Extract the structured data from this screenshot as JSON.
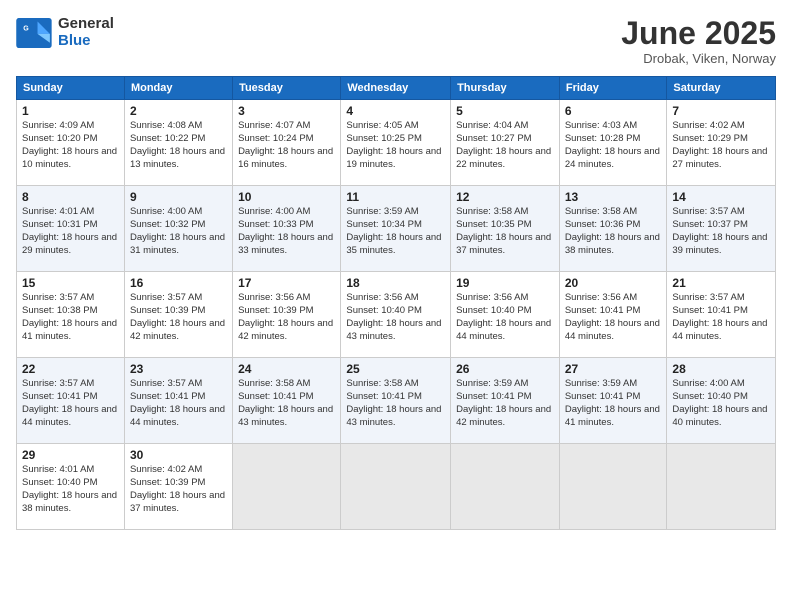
{
  "header": {
    "logo_general": "General",
    "logo_blue": "Blue",
    "month_title": "June 2025",
    "location": "Drobak, Viken, Norway"
  },
  "weekdays": [
    "Sunday",
    "Monday",
    "Tuesday",
    "Wednesday",
    "Thursday",
    "Friday",
    "Saturday"
  ],
  "weeks": [
    [
      {
        "day": "1",
        "sunrise": "Sunrise: 4:09 AM",
        "sunset": "Sunset: 10:20 PM",
        "daylight": "Daylight: 18 hours and 10 minutes."
      },
      {
        "day": "2",
        "sunrise": "Sunrise: 4:08 AM",
        "sunset": "Sunset: 10:22 PM",
        "daylight": "Daylight: 18 hours and 13 minutes."
      },
      {
        "day": "3",
        "sunrise": "Sunrise: 4:07 AM",
        "sunset": "Sunset: 10:24 PM",
        "daylight": "Daylight: 18 hours and 16 minutes."
      },
      {
        "day": "4",
        "sunrise": "Sunrise: 4:05 AM",
        "sunset": "Sunset: 10:25 PM",
        "daylight": "Daylight: 18 hours and 19 minutes."
      },
      {
        "day": "5",
        "sunrise": "Sunrise: 4:04 AM",
        "sunset": "Sunset: 10:27 PM",
        "daylight": "Daylight: 18 hours and 22 minutes."
      },
      {
        "day": "6",
        "sunrise": "Sunrise: 4:03 AM",
        "sunset": "Sunset: 10:28 PM",
        "daylight": "Daylight: 18 hours and 24 minutes."
      },
      {
        "day": "7",
        "sunrise": "Sunrise: 4:02 AM",
        "sunset": "Sunset: 10:29 PM",
        "daylight": "Daylight: 18 hours and 27 minutes."
      }
    ],
    [
      {
        "day": "8",
        "sunrise": "Sunrise: 4:01 AM",
        "sunset": "Sunset: 10:31 PM",
        "daylight": "Daylight: 18 hours and 29 minutes."
      },
      {
        "day": "9",
        "sunrise": "Sunrise: 4:00 AM",
        "sunset": "Sunset: 10:32 PM",
        "daylight": "Daylight: 18 hours and 31 minutes."
      },
      {
        "day": "10",
        "sunrise": "Sunrise: 4:00 AM",
        "sunset": "Sunset: 10:33 PM",
        "daylight": "Daylight: 18 hours and 33 minutes."
      },
      {
        "day": "11",
        "sunrise": "Sunrise: 3:59 AM",
        "sunset": "Sunset: 10:34 PM",
        "daylight": "Daylight: 18 hours and 35 minutes."
      },
      {
        "day": "12",
        "sunrise": "Sunrise: 3:58 AM",
        "sunset": "Sunset: 10:35 PM",
        "daylight": "Daylight: 18 hours and 37 minutes."
      },
      {
        "day": "13",
        "sunrise": "Sunrise: 3:58 AM",
        "sunset": "Sunset: 10:36 PM",
        "daylight": "Daylight: 18 hours and 38 minutes."
      },
      {
        "day": "14",
        "sunrise": "Sunrise: 3:57 AM",
        "sunset": "Sunset: 10:37 PM",
        "daylight": "Daylight: 18 hours and 39 minutes."
      }
    ],
    [
      {
        "day": "15",
        "sunrise": "Sunrise: 3:57 AM",
        "sunset": "Sunset: 10:38 PM",
        "daylight": "Daylight: 18 hours and 41 minutes."
      },
      {
        "day": "16",
        "sunrise": "Sunrise: 3:57 AM",
        "sunset": "Sunset: 10:39 PM",
        "daylight": "Daylight: 18 hours and 42 minutes."
      },
      {
        "day": "17",
        "sunrise": "Sunrise: 3:56 AM",
        "sunset": "Sunset: 10:39 PM",
        "daylight": "Daylight: 18 hours and 42 minutes."
      },
      {
        "day": "18",
        "sunrise": "Sunrise: 3:56 AM",
        "sunset": "Sunset: 10:40 PM",
        "daylight": "Daylight: 18 hours and 43 minutes."
      },
      {
        "day": "19",
        "sunrise": "Sunrise: 3:56 AM",
        "sunset": "Sunset: 10:40 PM",
        "daylight": "Daylight: 18 hours and 44 minutes."
      },
      {
        "day": "20",
        "sunrise": "Sunrise: 3:56 AM",
        "sunset": "Sunset: 10:41 PM",
        "daylight": "Daylight: 18 hours and 44 minutes."
      },
      {
        "day": "21",
        "sunrise": "Sunrise: 3:57 AM",
        "sunset": "Sunset: 10:41 PM",
        "daylight": "Daylight: 18 hours and 44 minutes."
      }
    ],
    [
      {
        "day": "22",
        "sunrise": "Sunrise: 3:57 AM",
        "sunset": "Sunset: 10:41 PM",
        "daylight": "Daylight: 18 hours and 44 minutes."
      },
      {
        "day": "23",
        "sunrise": "Sunrise: 3:57 AM",
        "sunset": "Sunset: 10:41 PM",
        "daylight": "Daylight: 18 hours and 44 minutes."
      },
      {
        "day": "24",
        "sunrise": "Sunrise: 3:58 AM",
        "sunset": "Sunset: 10:41 PM",
        "daylight": "Daylight: 18 hours and 43 minutes."
      },
      {
        "day": "25",
        "sunrise": "Sunrise: 3:58 AM",
        "sunset": "Sunset: 10:41 PM",
        "daylight": "Daylight: 18 hours and 43 minutes."
      },
      {
        "day": "26",
        "sunrise": "Sunrise: 3:59 AM",
        "sunset": "Sunset: 10:41 PM",
        "daylight": "Daylight: 18 hours and 42 minutes."
      },
      {
        "day": "27",
        "sunrise": "Sunrise: 3:59 AM",
        "sunset": "Sunset: 10:41 PM",
        "daylight": "Daylight: 18 hours and 41 minutes."
      },
      {
        "day": "28",
        "sunrise": "Sunrise: 4:00 AM",
        "sunset": "Sunset: 10:40 PM",
        "daylight": "Daylight: 18 hours and 40 minutes."
      }
    ],
    [
      {
        "day": "29",
        "sunrise": "Sunrise: 4:01 AM",
        "sunset": "Sunset: 10:40 PM",
        "daylight": "Daylight: 18 hours and 38 minutes."
      },
      {
        "day": "30",
        "sunrise": "Sunrise: 4:02 AM",
        "sunset": "Sunset: 10:39 PM",
        "daylight": "Daylight: 18 hours and 37 minutes."
      },
      null,
      null,
      null,
      null,
      null
    ]
  ]
}
